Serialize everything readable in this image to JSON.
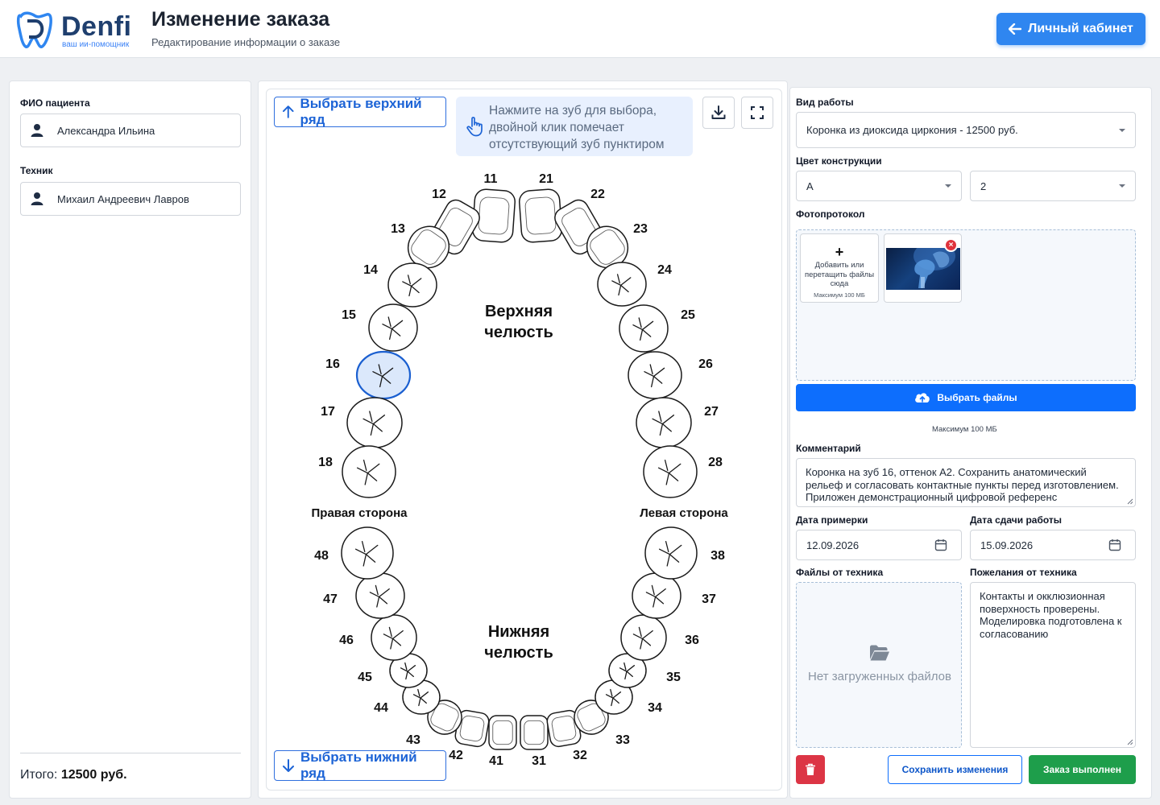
{
  "header": {
    "logo_word": "Denfi",
    "logo_sub": "ваш ии-помощник",
    "title": "Изменение заказа",
    "subtitle": "Редактирование информации о заказе",
    "cabinet_button": "Личный кабинет"
  },
  "left": {
    "patient_label": "ФИО пациента",
    "patient_name": "Александра Ильина",
    "technician_label": "Техник",
    "technician_name": "Михаил Андреевич Лавров",
    "total_label": "Итого:",
    "total_value": "12500 руб."
  },
  "center": {
    "upper_row_button": "Выбрать верхний ряд",
    "lower_row_button": "Выбрать нижний ряд",
    "hint": "Нажмите на зуб для выбора, двойной клик помечает отсутствующий зуб пунктиром",
    "download_icon": "download-icon",
    "fullscreen_icon": "fullscreen-icon",
    "upper_jaw_line1": "Верхняя",
    "upper_jaw_line2": "челюсть",
    "lower_jaw_line1": "Нижняя",
    "lower_jaw_line2": "челюсть",
    "right_side": "Правая сторона",
    "left_side": "Левая сторона",
    "selected_color": "#dbe8fb",
    "selected_stroke": "#1a5fd0",
    "teeth": [
      {
        "n": "11",
        "selected": false
      },
      {
        "n": "12",
        "selected": false
      },
      {
        "n": "13",
        "selected": false
      },
      {
        "n": "14",
        "selected": false
      },
      {
        "n": "15",
        "selected": false
      },
      {
        "n": "16",
        "selected": true
      },
      {
        "n": "17",
        "selected": false
      },
      {
        "n": "18",
        "selected": false
      },
      {
        "n": "21",
        "selected": false
      },
      {
        "n": "22",
        "selected": false
      },
      {
        "n": "23",
        "selected": false
      },
      {
        "n": "24",
        "selected": false
      },
      {
        "n": "25",
        "selected": false
      },
      {
        "n": "26",
        "selected": false
      },
      {
        "n": "27",
        "selected": false
      },
      {
        "n": "28",
        "selected": false
      },
      {
        "n": "31",
        "selected": false
      },
      {
        "n": "32",
        "selected": false
      },
      {
        "n": "33",
        "selected": false
      },
      {
        "n": "34",
        "selected": false
      },
      {
        "n": "35",
        "selected": false
      },
      {
        "n": "36",
        "selected": false
      },
      {
        "n": "37",
        "selected": false
      },
      {
        "n": "38",
        "selected": false
      },
      {
        "n": "41",
        "selected": false
      },
      {
        "n": "42",
        "selected": false
      },
      {
        "n": "43",
        "selected": false
      },
      {
        "n": "44",
        "selected": false
      },
      {
        "n": "45",
        "selected": false
      },
      {
        "n": "46",
        "selected": false
      },
      {
        "n": "47",
        "selected": false
      },
      {
        "n": "48",
        "selected": false
      }
    ]
  },
  "right": {
    "work_type_label": "Вид работы",
    "work_type_value": "Коронка из диоксида циркония - 12500 руб.",
    "color_label": "Цвет конструкции",
    "color_value_1": "A",
    "color_value_2": "2",
    "photo_label": "Фотопротокол",
    "add_plus": "+",
    "add_text": "Добавить или перетащить файлы сюда",
    "add_max": "Максимум 100 МБ",
    "remove_symbol": "×",
    "upload_button": "Выбрать файлы",
    "upload_max": "Максимум 100 МБ",
    "comment_label": "Комментарий",
    "comment_value": "Коронка на зуб 16, оттенок A2. Сохранить анатомический рельеф и согласовать контактные пункты перед изготовлением. Приложен демонстрационный цифровой референс",
    "fitting_date_label": "Дата примерки",
    "fitting_date": "12.09.2026",
    "delivery_date_label": "Дата сдачи работы",
    "delivery_date": "15.09.2026",
    "tech_files_label": "Файлы от техника",
    "tech_files_empty": "Нет загруженных файлов",
    "tech_wishes_label": "Пожелания от техника",
    "tech_wishes_value": "Контакты и окклюзионная поверхность проверены. Моделировка подготовлена к согласованию",
    "save_button": "Сохранить изменения",
    "done_button": "Заказ выполнен"
  }
}
